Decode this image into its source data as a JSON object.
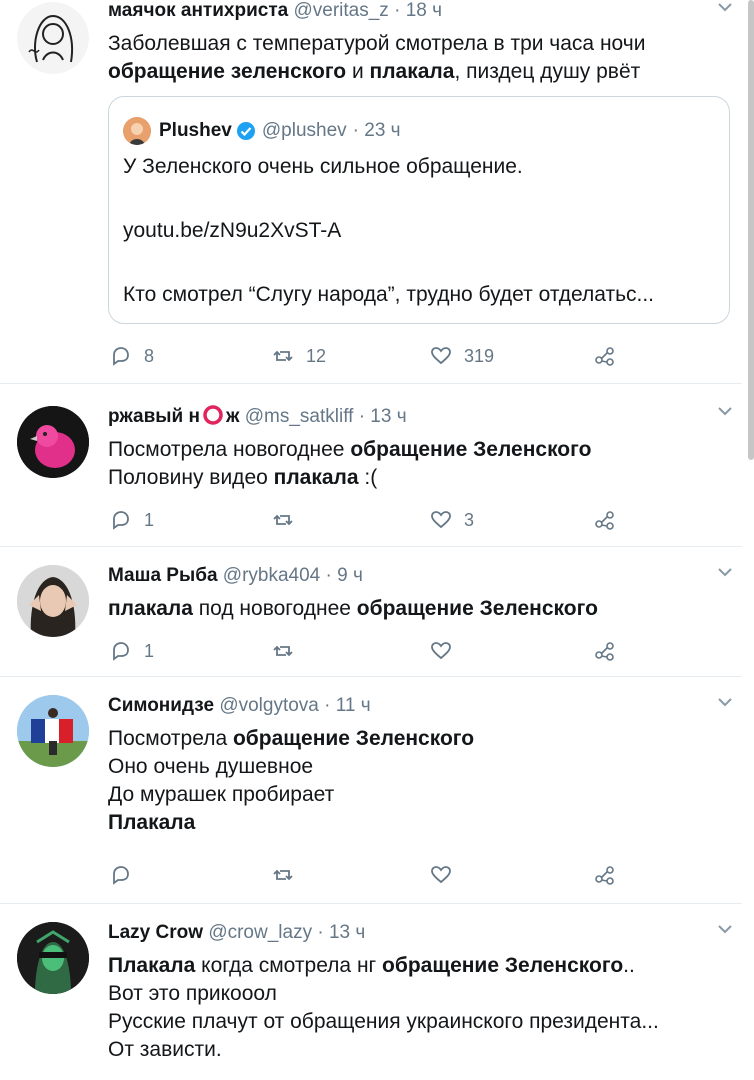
{
  "tweets": [
    {
      "name": "маячок антихриста",
      "handle": "@veritas_z",
      "time": "· 18 ч",
      "lines": [
        [
          {
            "t": "Заболевшая с температурой смотрела в три часа ночи",
            "b": false
          }
        ],
        [
          {
            "t": "обращение зеленского",
            "b": true
          },
          {
            "t": " и ",
            "b": false
          },
          {
            "t": "плакала",
            "b": true
          },
          {
            "t": ", пиздец душу рвёт",
            "b": false
          }
        ]
      ],
      "quote": {
        "name": "Plushev",
        "handle": "@plushev",
        "time": "· 23 ч",
        "lines": [
          "У Зеленского очень сильное обращение.",
          "youtu.be/zN9u2XvST-A",
          "Кто смотрел “Слугу народа”, трудно будет отделатьс..."
        ]
      },
      "replies": "8",
      "retweets": "12",
      "likes": "319"
    },
    {
      "name": "ржавый н",
      "name_tail": "ж",
      "handle": "@ms_satkliff",
      "time": "· 13 ч",
      "lines": [
        [
          {
            "t": "Посмотрела новогоднее ",
            "b": false
          },
          {
            "t": "обращение Зеленского",
            "b": true
          }
        ],
        [
          {
            "t": "Половину видео ",
            "b": false
          },
          {
            "t": "плакала",
            "b": true
          },
          {
            "t": " :(",
            "b": false
          }
        ]
      ],
      "replies": "1",
      "retweets": "",
      "likes": "3"
    },
    {
      "name": "Маша Рыба",
      "handle": "@rybka404",
      "time": "· 9 ч",
      "lines": [
        [
          {
            "t": "плакала",
            "b": true
          },
          {
            "t": " под новогоднее ",
            "b": false
          },
          {
            "t": "обращение Зеленского",
            "b": true
          }
        ]
      ],
      "replies": "1",
      "retweets": "",
      "likes": ""
    },
    {
      "name": "Симонидзе",
      "handle": "@volgytova",
      "time": "· 11 ч",
      "lines": [
        [
          {
            "t": "Посмотрела ",
            "b": false
          },
          {
            "t": "обращение Зеленского",
            "b": true
          }
        ],
        [
          {
            "t": "Оно очень душевное",
            "b": false
          }
        ],
        [
          {
            "t": "До мурашек пробирает",
            "b": false
          }
        ],
        [
          {
            "t": "Плакала",
            "b": true
          }
        ]
      ],
      "replies": "",
      "retweets": "",
      "likes": ""
    },
    {
      "name": "Lazy Crow",
      "handle": "@crow_lazy",
      "time": "· 13 ч",
      "lines": [
        [
          {
            "t": "Плакала",
            "b": true
          },
          {
            "t": " когда смотрела нг ",
            "b": false
          },
          {
            "t": "обращение Зеленского",
            "b": true
          },
          {
            "t": "..",
            "b": false
          }
        ],
        [
          {
            "t": "Вот это прикооол",
            "b": false
          }
        ],
        [
          {
            "t": "Русские плачут от обращения украинского президента...",
            "b": false
          }
        ],
        [
          {
            "t": "От зависти.",
            "b": false
          }
        ]
      ]
    }
  ],
  "icons": {
    "reply": "reply-icon",
    "retweet": "retweet-icon",
    "like": "heart-icon",
    "share": "share-icon",
    "caret": "chevron-down-icon",
    "verified": "verified-badge-icon"
  },
  "colors": {
    "text": "#14171a",
    "meta": "#657786",
    "border": "#e6ecf0",
    "verified": "#1da1f2"
  }
}
